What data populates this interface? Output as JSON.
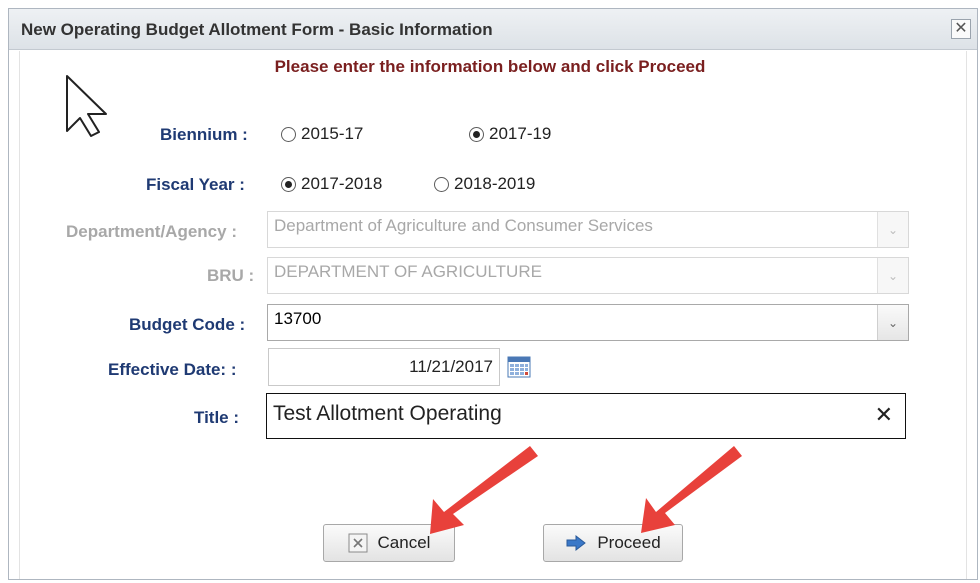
{
  "window": {
    "title": "New Operating Budget Allotment Form - Basic Information",
    "close": "✕"
  },
  "instruction": "Please enter the information below and click Proceed",
  "biennium": {
    "label": "Biennium :",
    "options": [
      "2015-17",
      "2017-19"
    ],
    "selected": "2017-19"
  },
  "fiscal_year": {
    "label": "Fiscal Year :",
    "options": [
      "2017-2018",
      "2018-2019"
    ],
    "selected": "2017-2018"
  },
  "department": {
    "label": "Department/Agency :",
    "value": "Department of Agriculture and Consumer Services",
    "disabled": true
  },
  "bru": {
    "label": "BRU :",
    "value": "DEPARTMENT OF AGRICULTURE",
    "disabled": true
  },
  "budget_code": {
    "label": "Budget Code :",
    "value": "13700"
  },
  "effective_date": {
    "label": "Effective Date: :",
    "value": "11/21/2017"
  },
  "title_field": {
    "label": "Title :",
    "value": "Test Allotment Operating"
  },
  "buttons": {
    "cancel": "Cancel",
    "proceed": "Proceed"
  },
  "colors": {
    "label": "#1f3a73",
    "instruction": "#7a1f1f",
    "annotation_arrow": "#e8413b"
  },
  "icons": [
    "close-icon",
    "chevron-down-icon",
    "calendar-icon",
    "cancel-x-icon",
    "arrow-right-icon",
    "mouse-cursor-icon"
  ]
}
